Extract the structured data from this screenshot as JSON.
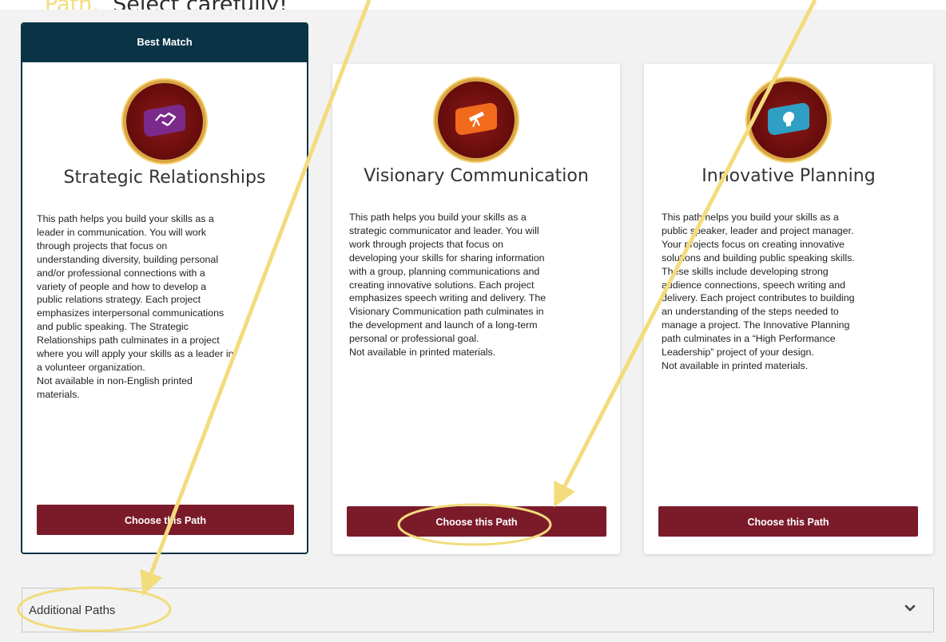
{
  "instruction": {
    "accent_text": "Path.",
    "text": "Select carefully!"
  },
  "colors": {
    "navy": "#0a3346",
    "maroon": "#7b1b2a",
    "annotation_yellow": "#f2dc7c"
  },
  "best_match_label": "Best Match",
  "cards": [
    {
      "title": "Strategic Relationships",
      "icon": "handshake-icon",
      "flag_color": "#7b2a8c",
      "description": "This path helps you build your skills as a\nleader in communication. You will work\nthrough projects that focus on\nunderstanding diversity, building personal\nand/or professional connections with a\nvariety of people and how to develop a\npublic relations strategy. Each project\nemphasizes interpersonal communications\nand public speaking. The Strategic\nRelationships path culminates in a project\nwhere you will apply your skills as a leader in\na volunteer organization.\nNot available in non-English printed\nmaterials.",
      "button": "Choose this Path"
    },
    {
      "title": "Visionary Communication",
      "icon": "telescope-icon",
      "flag_color": "#f26a1b",
      "description": "This path helps you build your skills as a\nstrategic communicator and leader. You will\nwork through projects that focus on\ndeveloping your skills for sharing information\nwith a group, planning communications and\ncreating innovative solutions. Each project\nemphasizes speech writing and delivery. The\nVisionary Communication path culminates in\nthe development and launch of a long-term\npersonal or professional goal.\nNot available in printed materials.",
      "button": "Choose this Path"
    },
    {
      "title": "Innovative Planning",
      "icon": "lightbulb-icon",
      "flag_color": "#2f9fc4",
      "description": "This path helps you build your skills as a\npublic speaker, leader and project manager.\nYour projects focus on creating innovative\nsolutions and building public speaking skills.\nThese skills include developing strong\naudience connections, speech writing and\ndelivery. Each project contributes to building\nan understanding of the steps needed to\nmanage a project. The Innovative Planning\npath culminates in a “High Performance\nLeadership” project of your design.\nNot available in printed materials.",
      "button": "Choose this Path"
    }
  ],
  "additional_paths": {
    "label": "Additional Paths",
    "icon": "chevron-down-icon"
  }
}
